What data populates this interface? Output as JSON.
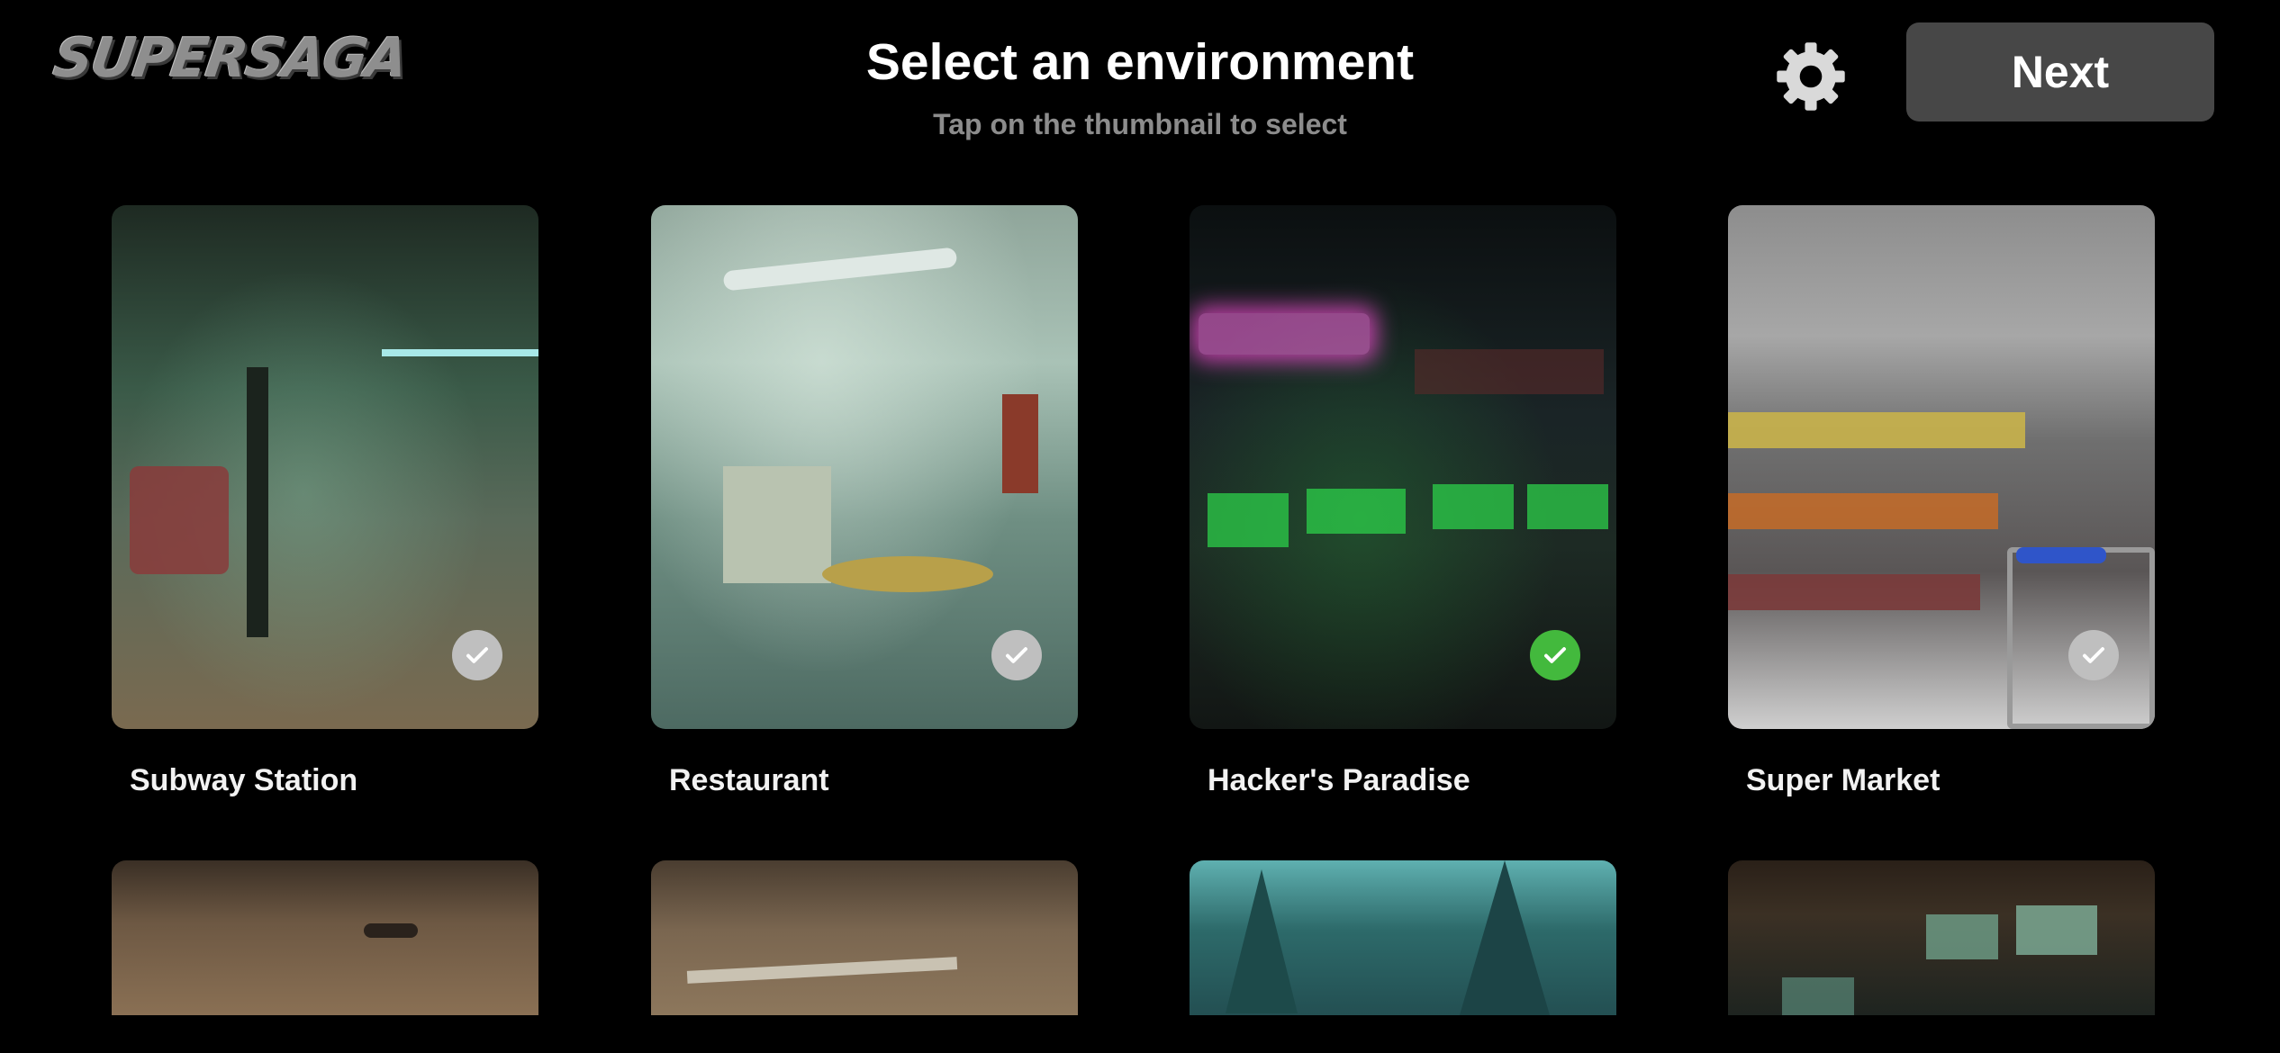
{
  "header": {
    "logo_text": "SUPERSAGA",
    "title": "Select an environment",
    "subtitle": "Tap on the thumbnail to select",
    "settings_icon": "gear-icon",
    "next_label": "Next"
  },
  "environments": [
    {
      "label": "Subway Station",
      "selected": false,
      "check_icon": "checkmark-icon"
    },
    {
      "label": "Restaurant",
      "selected": false,
      "check_icon": "checkmark-icon"
    },
    {
      "label": "Hacker's Paradise",
      "selected": true,
      "check_icon": "checkmark-icon"
    },
    {
      "label": "Super Market",
      "selected": false,
      "check_icon": "checkmark-icon"
    }
  ],
  "colors": {
    "background": "#000000",
    "button_bg": "#474747",
    "selected_check": "#43b93d",
    "unselected_check": "#bfbfbf",
    "subtitle": "#8c8c8c"
  }
}
